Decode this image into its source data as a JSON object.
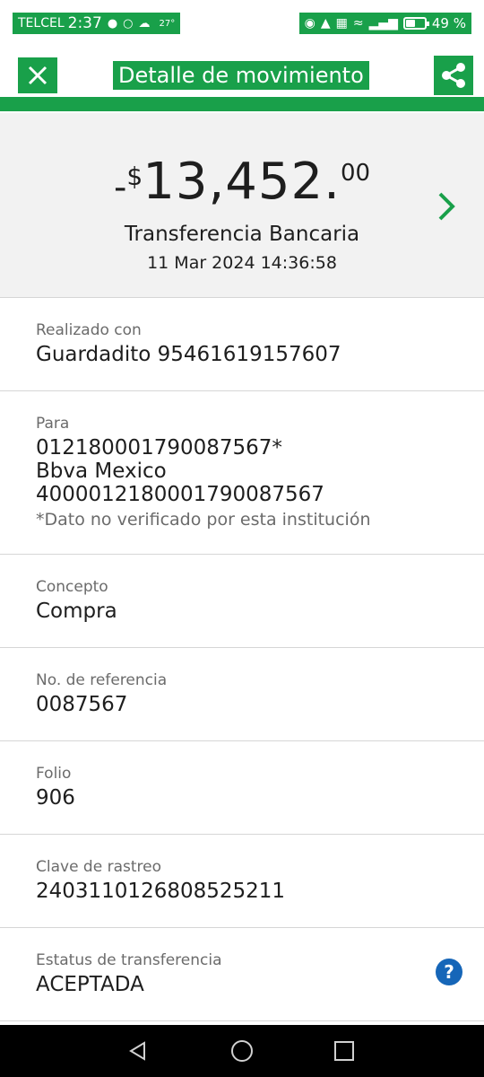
{
  "status_bar": {
    "carrier": "TELCEL",
    "time": "2:37",
    "temperature": "27°",
    "battery": "49 %",
    "battery_level": 0.49
  },
  "header": {
    "title": "Detalle de movimiento",
    "close_icon": "close-icon",
    "share_icon": "share-icon"
  },
  "summary": {
    "sign": "-",
    "currency": "$",
    "amount_int": "13,452.",
    "amount_dec": "00",
    "type": "Transferencia Bancaria",
    "date": "11 Mar 2024 14:36:58"
  },
  "details": {
    "realizado": {
      "label": "Realizado con",
      "value": "Guardadito 95461619157607"
    },
    "para": {
      "label": "Para",
      "line1": "012180001790087567*",
      "line2": "Bbva Mexico",
      "line3": "4000012180001790087567",
      "note": "*Dato no verificado por esta institución"
    },
    "concepto": {
      "label": "Concepto",
      "value": "Compra"
    },
    "referencia": {
      "label": "No. de referencia",
      "value": "0087567"
    },
    "folio": {
      "label": "Folio",
      "value": "906"
    },
    "rastreo": {
      "label": "Clave de rastreo",
      "value": "2403110126808525211"
    },
    "estatus": {
      "label": "Estatus de transferencia",
      "value": "ACEPTADA",
      "help": "?"
    }
  },
  "colors": {
    "accent": "#19a04a",
    "help": "#1666b8",
    "summary_bg": "#f2f2f2"
  }
}
